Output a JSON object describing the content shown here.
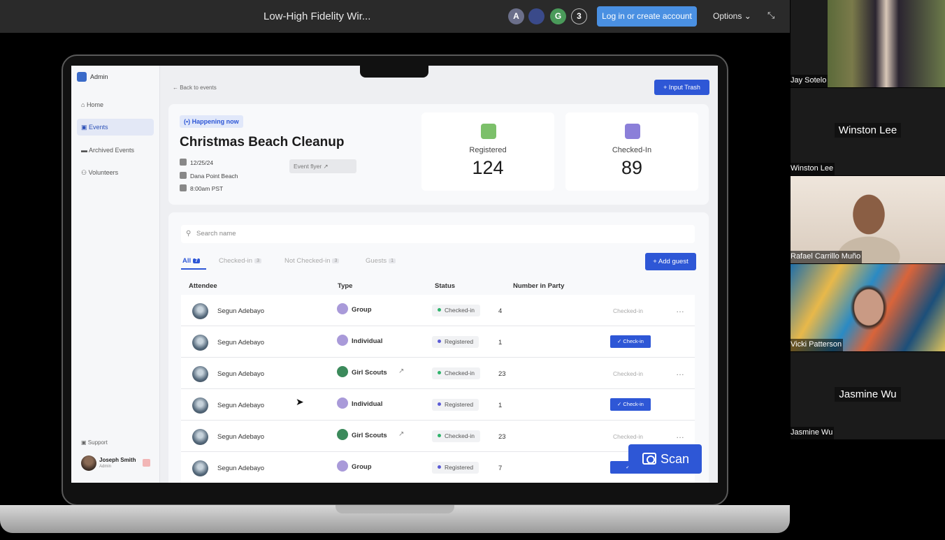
{
  "topbar": {
    "title": "Low-High Fidelity Wir...",
    "avatars": [
      {
        "letter": "A",
        "color": "#6b6f8a"
      },
      {
        "letter": "",
        "color": "#3a4a8a"
      },
      {
        "letter": "G",
        "color": "#4a9a5a"
      },
      {
        "letter": "3",
        "color": "#2a2a2a"
      }
    ],
    "login_label": "Log in or create account",
    "options_label": "Options ⌄"
  },
  "sidebar": {
    "app_name": "Admin",
    "items": [
      {
        "label": "Home",
        "icon": "home-icon"
      },
      {
        "label": "Events",
        "icon": "calendar-icon"
      },
      {
        "label": "Archived Events",
        "icon": "archive-icon"
      },
      {
        "label": "Volunteers",
        "icon": "users-icon"
      }
    ],
    "support_label": "Support",
    "user_name": "Joseph Smith",
    "user_role": "Admin"
  },
  "main": {
    "back_label": "← Back to events",
    "input_trash_label": "+ Input Trash",
    "event": {
      "badge": "(•) Happening now",
      "title": "Christmas Beach Cleanup",
      "date": "12/25/24",
      "location": "Dana Point Beach",
      "time": "8:00am PST",
      "flyer_label": "Event flyer ↗"
    },
    "stats": [
      {
        "label": "Registered",
        "value": "124",
        "color": "#7cc06a"
      },
      {
        "label": "Checked-In",
        "value": "89",
        "color": "#8b7fd9"
      }
    ],
    "search_placeholder": "Search name",
    "tabs": [
      {
        "label": "All",
        "count": "7"
      },
      {
        "label": "Checked-in",
        "count": "3"
      },
      {
        "label": "Not Checked-in",
        "count": "3"
      },
      {
        "label": "Guests",
        "count": "1"
      }
    ],
    "add_guest_label": "+ Add guest",
    "columns": [
      "Attendee",
      "Type",
      "Status",
      "Number in Party"
    ],
    "rows": [
      {
        "name": "Segun Adebayo",
        "type": "Group",
        "status": "Checked-in",
        "party": "4",
        "action": "Checked-in"
      },
      {
        "name": "Segun Adebayo",
        "type": "Individual",
        "status": "Registered",
        "party": "1",
        "action": "✓ Check-in"
      },
      {
        "name": "Segun Adebayo",
        "type": "Girl Scouts",
        "status": "Checked-in",
        "party": "23",
        "action": "Checked-in"
      },
      {
        "name": "Segun Adebayo",
        "type": "Individual",
        "status": "Registered",
        "party": "1",
        "action": "✓ Check-in"
      },
      {
        "name": "Segun Adebayo",
        "type": "Girl Scouts",
        "status": "Checked-in",
        "party": "23",
        "action": "Checked-in"
      },
      {
        "name": "Segun Adebayo",
        "type": "Group",
        "status": "Registered",
        "party": "7",
        "action": "✓ C"
      }
    ],
    "scan_label": "Scan"
  },
  "participants": [
    {
      "name": "Jay Sotelo",
      "video": true
    },
    {
      "name": "Winston Lee",
      "video": false
    },
    {
      "name": "Rafael Carrillo Muño",
      "video": true
    },
    {
      "name": "Vicki Patterson",
      "video": true
    },
    {
      "name": "Jasmine Wu",
      "video": false
    }
  ],
  "colors": {
    "accent": "#2e57d6",
    "login_button": "#4a90e2"
  }
}
